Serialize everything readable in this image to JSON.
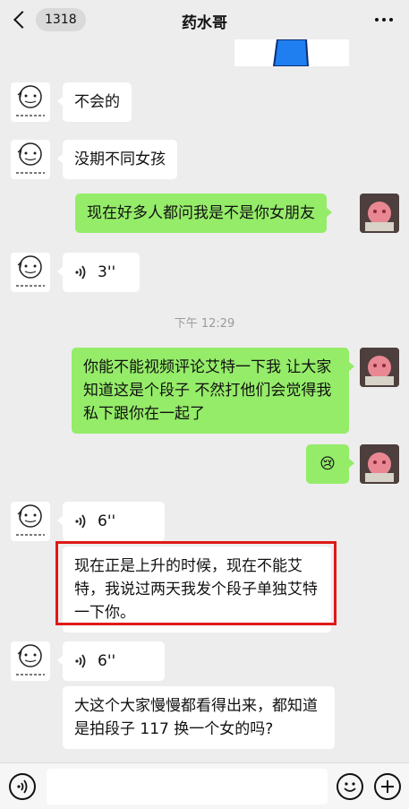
{
  "header": {
    "back_count": "1318",
    "title": "药水哥"
  },
  "messages": {
    "m1": "不会的",
    "m2": "没期不同女孩",
    "m3": "现在好多人都问我是不是你女朋友",
    "m4_duration": "3''",
    "time": "下午 12:29",
    "m5": "你能不能视频评论艾特一下我 让大家知道这是个段子 不然打他们会觉得我私下跟你在一起了",
    "m6_emoji": "😢",
    "m7_duration": "6''",
    "m8": "现在正是上升的时候，现在不能艾特，我说过两天我发个段子单独艾特一下你。",
    "m9_duration": "6''",
    "m10": "大这个大家慢慢都看得出来，都知道是拍段子 117 换一个女的吗?"
  },
  "colors": {
    "incoming": "#ffffff",
    "outgoing": "#95ec69",
    "highlight": "#e01818",
    "background": "#ededed"
  }
}
